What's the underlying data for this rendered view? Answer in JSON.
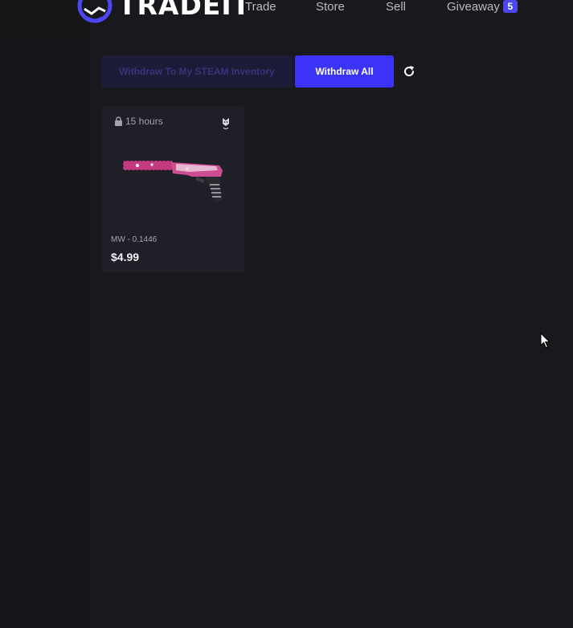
{
  "brand": {
    "name": "TRADEIT",
    "accent": "#4c46f0"
  },
  "nav": {
    "links": [
      {
        "label": "Trade"
      },
      {
        "label": "Store"
      },
      {
        "label": "Sell"
      },
      {
        "label": "Giveaway",
        "badge": "5"
      }
    ]
  },
  "actions": {
    "withdraw_steam_label": "Withdraw To My STEAM Inventory",
    "withdraw_all_label": "Withdraw All",
    "refresh_icon": "refresh-icon"
  },
  "items": [
    {
      "lock_label": "15 hours",
      "lock_icon": "lock-icon",
      "sticker_icon": "sticker-icon",
      "wear": "MW - 0.1446",
      "price": "$4.99"
    }
  ],
  "colors": {
    "background": "#15151a",
    "panel": "#18181d",
    "card": "#1f1f27",
    "primary_button": "#3b33f6",
    "disabled_button": "#1c1b38"
  }
}
